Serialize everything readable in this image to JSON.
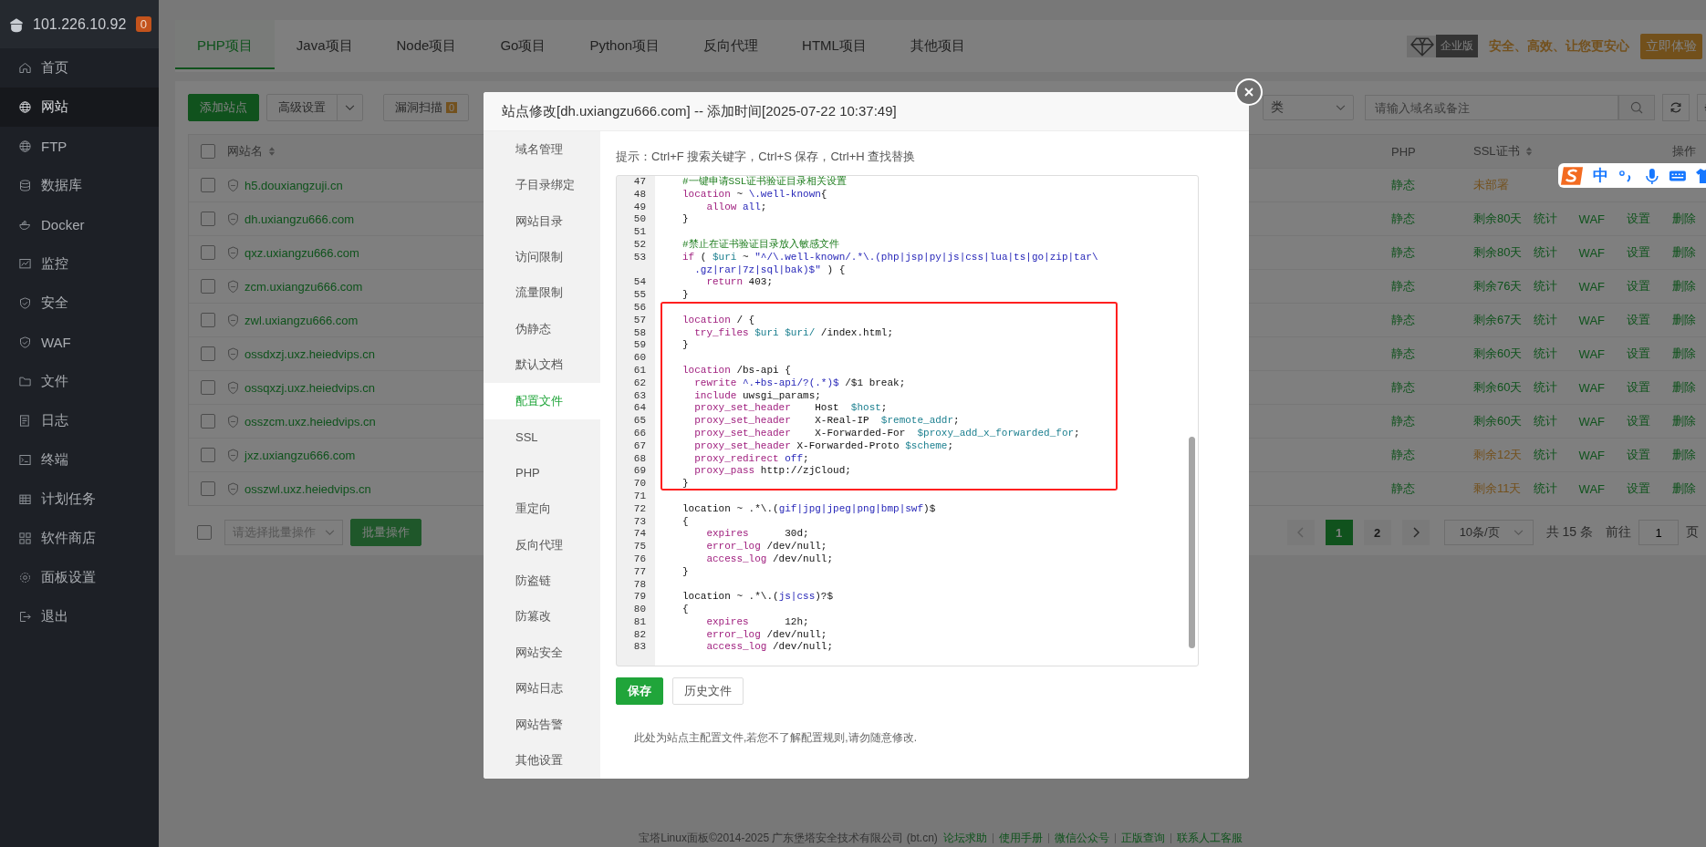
{
  "sidebar": {
    "host": "101.226.10.92",
    "badge": "0",
    "items": [
      {
        "label": "首页",
        "selected": false
      },
      {
        "label": "网站",
        "selected": true
      },
      {
        "label": "FTP",
        "selected": false
      },
      {
        "label": "数据库",
        "selected": false
      },
      {
        "label": "Docker",
        "selected": false
      },
      {
        "label": "监控",
        "selected": false
      },
      {
        "label": "安全",
        "selected": false
      },
      {
        "label": "WAF",
        "selected": false
      },
      {
        "label": "文件",
        "selected": false
      },
      {
        "label": "日志",
        "selected": false
      },
      {
        "label": "终端",
        "selected": false
      },
      {
        "label": "计划任务",
        "selected": false
      },
      {
        "label": "软件商店",
        "selected": false
      },
      {
        "label": "面板设置",
        "selected": false
      },
      {
        "label": "退出",
        "selected": false
      }
    ]
  },
  "tabs": [
    {
      "label": "PHP项目",
      "selected": true
    },
    {
      "label": "Java项目",
      "selected": false
    },
    {
      "label": "Node项目",
      "selected": false
    },
    {
      "label": "Go项目",
      "selected": false
    },
    {
      "label": "Python项目",
      "selected": false
    },
    {
      "label": "反向代理",
      "selected": false
    },
    {
      "label": "HTML项目",
      "selected": false
    },
    {
      "label": "其他项目",
      "selected": false
    }
  ],
  "promo": {
    "badge": "企业版",
    "slogan": "安全、高效、让您更安心",
    "button": "立即体验"
  },
  "toolbar": {
    "add_button": "添加站点",
    "settings_button": "高级设置",
    "scan_button": "漏洞扫描",
    "scan_count": "0",
    "category": "类",
    "search_placeholder": "请输入域名或备注"
  },
  "table": {
    "select_all_checked": false,
    "columns": [
      "网站名",
      "PHP",
      "SSL证书",
      "操作"
    ],
    "rows": [
      {
        "checked": false,
        "name": "h5.douxiangzuji.cn",
        "php": "静态",
        "ssl": "未部署",
        "ssl_warning": true
      },
      {
        "checked": false,
        "name": "dh.uxiangzu666.com",
        "php": "静态",
        "ssl": "剩余80天",
        "ssl_warning": false,
        "actions": [
          "统计",
          "WAF",
          "设置",
          "删除"
        ]
      },
      {
        "checked": false,
        "name": "qxz.uxiangzu666.com",
        "php": "静态",
        "ssl": "剩余80天",
        "ssl_warning": false,
        "actions": [
          "统计",
          "WAF",
          "设置",
          "删除"
        ]
      },
      {
        "checked": false,
        "name": "zcm.uxiangzu666.com",
        "php": "静态",
        "ssl": "剩余76天",
        "ssl_warning": false,
        "actions": [
          "统计",
          "WAF",
          "设置",
          "删除"
        ]
      },
      {
        "checked": false,
        "name": "zwl.uxiangzu666.com",
        "php": "静态",
        "ssl": "剩余67天",
        "ssl_warning": false,
        "actions": [
          "统计",
          "WAF",
          "设置",
          "删除"
        ]
      },
      {
        "checked": false,
        "name": "ossdxzj.uxz.heiedvips.cn",
        "php": "静态",
        "ssl": "剩余60天",
        "ssl_warning": false,
        "actions": [
          "统计",
          "WAF",
          "设置",
          "删除"
        ]
      },
      {
        "checked": false,
        "name": "ossqxzj.uxz.heiedvips.cn",
        "php": "静态",
        "ssl": "剩余60天",
        "ssl_warning": false,
        "actions": [
          "统计",
          "WAF",
          "设置",
          "删除"
        ]
      },
      {
        "checked": false,
        "name": "osszcm.uxz.heiedvips.cn",
        "php": "静态",
        "ssl": "剩余60天",
        "ssl_warning": false,
        "actions": [
          "统计",
          "WAF",
          "设置",
          "删除"
        ]
      },
      {
        "checked": false,
        "name": "jxz.uxiangzu666.com",
        "php": "静态",
        "ssl": "剩余12天",
        "ssl_warning": true,
        "actions": [
          "统计",
          "WAF",
          "设置",
          "删除"
        ]
      },
      {
        "checked": false,
        "name": "osszwl.uxz.heiedvips.cn",
        "php": "静态",
        "ssl": "剩余11天",
        "ssl_warning": true,
        "actions": [
          "统计",
          "WAF",
          "设置",
          "删除"
        ]
      }
    ]
  },
  "batch": {
    "checked": false,
    "select_placeholder": "请选择批量操作",
    "button": "批量操作"
  },
  "pagination": {
    "pages": [
      {
        "label": "1",
        "selected": true
      },
      {
        "label": "2",
        "selected": false
      }
    ],
    "page_size": "10条/页",
    "total": "共 15 条",
    "goto_label": "前往",
    "goto_value": "1",
    "page_unit": "页"
  },
  "footer": {
    "copyright": "宝塔Linux面板©2014-2025 广东堡塔安全技术有限公司 (bt.cn)",
    "links": [
      "论坛求助",
      "使用手册",
      "微信公众号",
      "正版查询",
      "联系人工客服"
    ]
  },
  "ime_toolbar": {
    "mode": "中"
  },
  "dialog": {
    "title": "站点修改[dh.uxiangzu666.com] -- 添加时间[2025-07-22 10:37:49]",
    "menu": [
      {
        "label": "域名管理",
        "selected": false
      },
      {
        "label": "子目录绑定",
        "selected": false
      },
      {
        "label": "网站目录",
        "selected": false
      },
      {
        "label": "访问限制",
        "selected": false
      },
      {
        "label": "流量限制",
        "selected": false
      },
      {
        "label": "伪静态",
        "selected": false
      },
      {
        "label": "默认文档",
        "selected": false
      },
      {
        "label": "配置文件",
        "selected": true
      },
      {
        "label": "SSL",
        "selected": false
      },
      {
        "label": "PHP",
        "selected": false
      },
      {
        "label": "重定向",
        "selected": false
      },
      {
        "label": "反向代理",
        "selected": false
      },
      {
        "label": "防盗链",
        "selected": false
      },
      {
        "label": "防篡改",
        "selected": false
      },
      {
        "label": "网站安全",
        "selected": false
      },
      {
        "label": "网站日志",
        "selected": false
      },
      {
        "label": "网站告警",
        "selected": false
      },
      {
        "label": "其他设置",
        "selected": false
      }
    ],
    "hint": "提示：Ctrl+F 搜索关键字，Ctrl+S 保存，Ctrl+H 查找替换",
    "editor": {
      "lines": [
        {
          "n": "47",
          "boxed": false,
          "code": [
            {
              "text": "#一键申请SSL证书验证目录相关设置",
              "kind": "comment"
            }
          ]
        },
        {
          "n": "48",
          "boxed": false,
          "code": [
            {
              "text": "location",
              "kind": "keyword"
            },
            {
              "text": " ~ ",
              "kind": "plain"
            },
            {
              "text": "\\.well-known",
              "kind": "regex"
            },
            {
              "text": "{",
              "kind": "plain"
            }
          ]
        },
        {
          "n": "49",
          "boxed": false,
          "code": [
            {
              "text": "    allow",
              "kind": "keyword"
            },
            {
              "text": " all",
              "kind": "regex"
            },
            {
              "text": ";",
              "kind": "plain"
            }
          ]
        },
        {
          "n": "50",
          "boxed": false,
          "code": [
            {
              "text": "}",
              "kind": "plain"
            }
          ]
        },
        {
          "n": "51",
          "boxed": false
        },
        {
          "n": "52",
          "boxed": false,
          "code": [
            {
              "text": "#禁止在证书验证目录放入敏感文件",
              "kind": "comment"
            }
          ]
        },
        {
          "n": "53",
          "boxed": false,
          "code": [
            {
              "text": "if",
              "kind": "keyword"
            },
            {
              "text": " ( ",
              "kind": "plain"
            },
            {
              "text": "$uri",
              "kind": "variable"
            },
            {
              "text": " ~ ",
              "kind": "plain"
            },
            {
              "text": "\"^/\\.well-known/.*\\.(php|jsp|py|js|css|lua|ts|go|zip|tar\\",
              "kind": "regex"
            }
          ]
        },
        {
          "boxed": false,
          "code": [
            {
              "text": "  .gz|rar|7z|sql|bak)$\"",
              "kind": "regex"
            },
            {
              "text": " ) {",
              "kind": "plain"
            }
          ]
        },
        {
          "n": "54",
          "boxed": false,
          "code": [
            {
              "text": "    return",
              "kind": "keyword"
            },
            {
              "text": " 403;",
              "kind": "plain"
            }
          ]
        },
        {
          "n": "55",
          "boxed": false,
          "code": [
            {
              "text": "}",
              "kind": "plain"
            }
          ]
        },
        {
          "n": "56",
          "boxed": true
        },
        {
          "n": "57",
          "boxed": true,
          "code": [
            {
              "text": "location",
              "kind": "keyword"
            },
            {
              "text": " / {",
              "kind": "plain"
            }
          ]
        },
        {
          "n": "58",
          "boxed": true,
          "code": [
            {
              "text": "  try_files",
              "kind": "keyword"
            },
            {
              "text": " $uri $uri/",
              "kind": "variable"
            },
            {
              "text": " /index.html;",
              "kind": "plain"
            }
          ]
        },
        {
          "n": "59",
          "boxed": true,
          "code": [
            {
              "text": "}",
              "kind": "plain"
            }
          ]
        },
        {
          "n": "60",
          "boxed": true
        },
        {
          "n": "61",
          "boxed": true,
          "code": [
            {
              "text": "location",
              "kind": "keyword"
            },
            {
              "text": " /bs-api {",
              "kind": "plain"
            }
          ]
        },
        {
          "n": "62",
          "boxed": true,
          "code": [
            {
              "text": "  rewrite",
              "kind": "keyword"
            },
            {
              "text": " ^.+bs-api/?(.*)$",
              "kind": "regex"
            },
            {
              "text": " /$1 break;",
              "kind": "plain"
            }
          ]
        },
        {
          "n": "63",
          "boxed": true,
          "code": [
            {
              "text": "  include",
              "kind": "keyword"
            },
            {
              "text": " uwsgi_params;",
              "kind": "plain"
            }
          ]
        },
        {
          "n": "64",
          "boxed": true,
          "code": [
            {
              "text": "  proxy_set_header",
              "kind": "keyword"
            },
            {
              "text": "    Host  ",
              "kind": "plain"
            },
            {
              "text": "$host",
              "kind": "variable"
            },
            {
              "text": ";",
              "kind": "plain"
            }
          ]
        },
        {
          "n": "65",
          "boxed": true,
          "code": [
            {
              "text": "  proxy_set_header",
              "kind": "keyword"
            },
            {
              "text": "    X-Real-IP  ",
              "kind": "plain"
            },
            {
              "text": "$remote_addr",
              "kind": "variable"
            },
            {
              "text": ";",
              "kind": "plain"
            }
          ]
        },
        {
          "n": "66",
          "boxed": true,
          "code": [
            {
              "text": "  proxy_set_header",
              "kind": "keyword"
            },
            {
              "text": "    X-Forwarded-For  ",
              "kind": "plain"
            },
            {
              "text": "$proxy_add_x_forwarded_for",
              "kind": "variable"
            },
            {
              "text": ";",
              "kind": "plain"
            }
          ]
        },
        {
          "n": "67",
          "boxed": true,
          "code": [
            {
              "text": "  proxy_set_header",
              "kind": "keyword"
            },
            {
              "text": " X-Forwarded-Proto ",
              "kind": "plain"
            },
            {
              "text": "$scheme",
              "kind": "variable"
            },
            {
              "text": ";",
              "kind": "plain"
            }
          ]
        },
        {
          "n": "68",
          "boxed": true,
          "code": [
            {
              "text": "  proxy_redirect",
              "kind": "keyword"
            },
            {
              "text": " off",
              "kind": "regex"
            },
            {
              "text": ";",
              "kind": "plain"
            }
          ]
        },
        {
          "n": "69",
          "boxed": true,
          "code": [
            {
              "text": "  proxy_pass",
              "kind": "keyword"
            },
            {
              "text": " http://zjCloud;",
              "kind": "plain"
            }
          ]
        },
        {
          "n": "70",
          "boxed": true,
          "code": [
            {
              "text": "}",
              "kind": "plain"
            }
          ]
        },
        {
          "n": "71",
          "boxed": false
        },
        {
          "n": "72",
          "boxed": false,
          "code": [
            {
              "text": "location ~ .*\\.(",
              "kind": "plain"
            },
            {
              "text": "gif|jpg|jpeg|png|bmp|swf",
              "kind": "regex"
            },
            {
              "text": ")$",
              "kind": "plain"
            }
          ]
        },
        {
          "n": "73",
          "boxed": false,
          "code": [
            {
              "text": "{",
              "kind": "plain"
            }
          ]
        },
        {
          "n": "74",
          "boxed": false,
          "code": [
            {
              "text": "    expires",
              "kind": "keyword"
            },
            {
              "text": "      30d;",
              "kind": "plain"
            }
          ]
        },
        {
          "n": "75",
          "boxed": false,
          "code": [
            {
              "text": "    error_log",
              "kind": "keyword"
            },
            {
              "text": " /dev/null;",
              "kind": "plain"
            }
          ]
        },
        {
          "n": "76",
          "boxed": false,
          "code": [
            {
              "text": "    access_log",
              "kind": "keyword"
            },
            {
              "text": " /dev/null;",
              "kind": "plain"
            }
          ]
        },
        {
          "n": "77",
          "boxed": false,
          "code": [
            {
              "text": "}",
              "kind": "plain"
            }
          ]
        },
        {
          "n": "78",
          "boxed": false
        },
        {
          "n": "79",
          "boxed": false,
          "code": [
            {
              "text": "location ~ .*\\.(",
              "kind": "plain"
            },
            {
              "text": "js|css",
              "kind": "regex"
            },
            {
              "text": ")?$",
              "kind": "plain"
            }
          ]
        },
        {
          "n": "80",
          "boxed": false,
          "code": [
            {
              "text": "{",
              "kind": "plain"
            }
          ]
        },
        {
          "n": "81",
          "boxed": false,
          "code": [
            {
              "text": "    expires",
              "kind": "keyword"
            },
            {
              "text": "      12h;",
              "kind": "plain"
            }
          ]
        },
        {
          "n": "82",
          "boxed": false,
          "code": [
            {
              "text": "    error_log",
              "kind": "keyword"
            },
            {
              "text": " /dev/null;",
              "kind": "plain"
            }
          ]
        },
        {
          "n": "83",
          "boxed": false,
          "code": [
            {
              "text": "    access_log",
              "kind": "keyword"
            },
            {
              "text": " /dev/null;",
              "kind": "plain"
            }
          ]
        }
      ]
    },
    "buttons": [
      {
        "label": "保存",
        "kind": "primary"
      },
      {
        "label": "历史文件",
        "kind": "default"
      }
    ],
    "note": "此处为站点主配置文件,若您不了解配置规则,请勿随意修改."
  }
}
